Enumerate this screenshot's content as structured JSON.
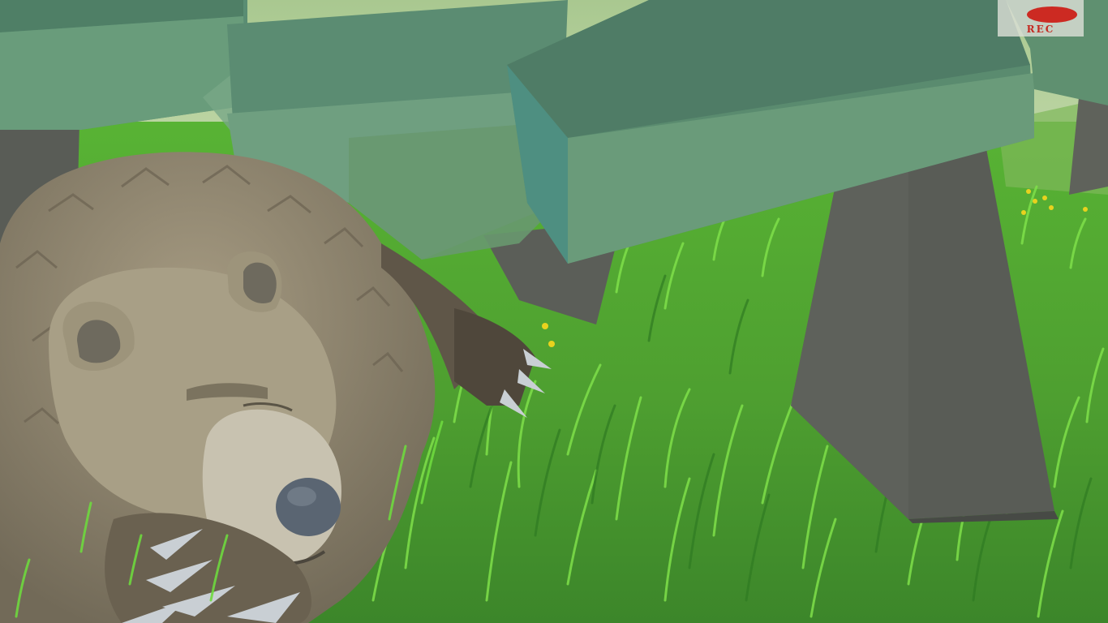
{
  "hud": {
    "record_indicator": {
      "label": "REC",
      "dot_color": "#cc2a22",
      "icon": "record-dot-icon"
    }
  },
  "scene": {
    "colors": {
      "sky": "#b9d6a4",
      "grass_light": "#6fcf3a",
      "grass_dark": "#3d8a2a",
      "foliage": "#5d8f74",
      "foliage_shadow": "#4f7c66",
      "trunk": "#595c56",
      "bear_fur": "#8f8570",
      "bear_face": "#b3aa90",
      "bear_muzzle": "#c8c2b0",
      "bear_nose": "#5a6572",
      "claws": "#c9cfd4",
      "flowers": "#e8d21e"
    }
  }
}
